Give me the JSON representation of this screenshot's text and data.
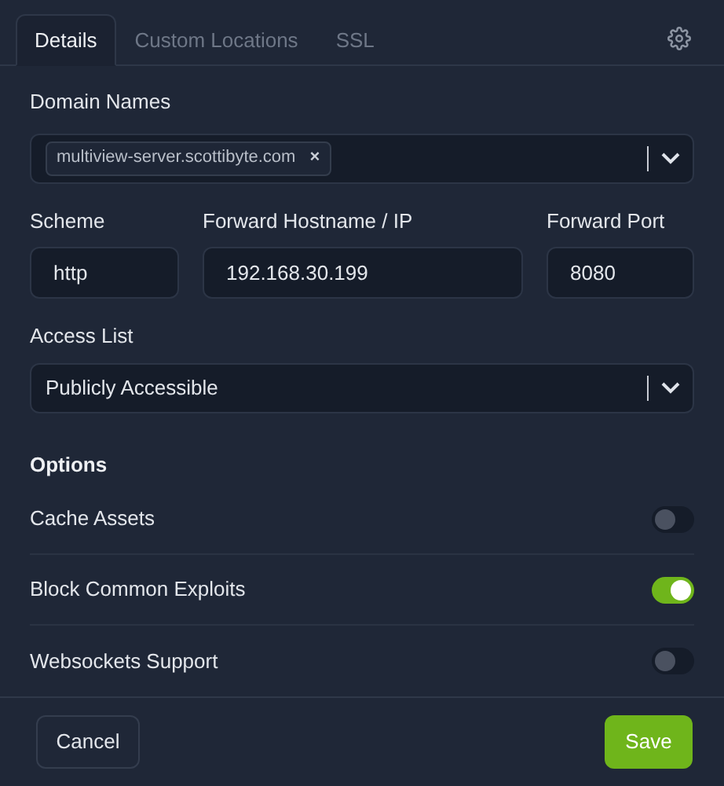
{
  "tabs": [
    {
      "label": "Details",
      "selected": true
    },
    {
      "label": "Custom Locations",
      "selected": false
    },
    {
      "label": "SSL",
      "selected": false
    }
  ],
  "domain_names": {
    "label": "Domain Names",
    "tags": [
      "multiview-server.scottibyte.com"
    ],
    "remove_mark": "×"
  },
  "scheme": {
    "label": "Scheme",
    "value": "http"
  },
  "forward_hostname": {
    "label": "Forward Hostname / IP",
    "value": "192.168.30.199"
  },
  "forward_port": {
    "label": "Forward Port",
    "value": "8080"
  },
  "access_list": {
    "label": "Access List",
    "value": "Publicly Accessible"
  },
  "options": {
    "title": "Options",
    "items": [
      {
        "label": "Cache Assets",
        "on": false
      },
      {
        "label": "Block Common Exploits",
        "on": true
      },
      {
        "label": "Websockets Support",
        "on": false
      }
    ]
  },
  "buttons": {
    "cancel": "Cancel",
    "save": "Save"
  }
}
